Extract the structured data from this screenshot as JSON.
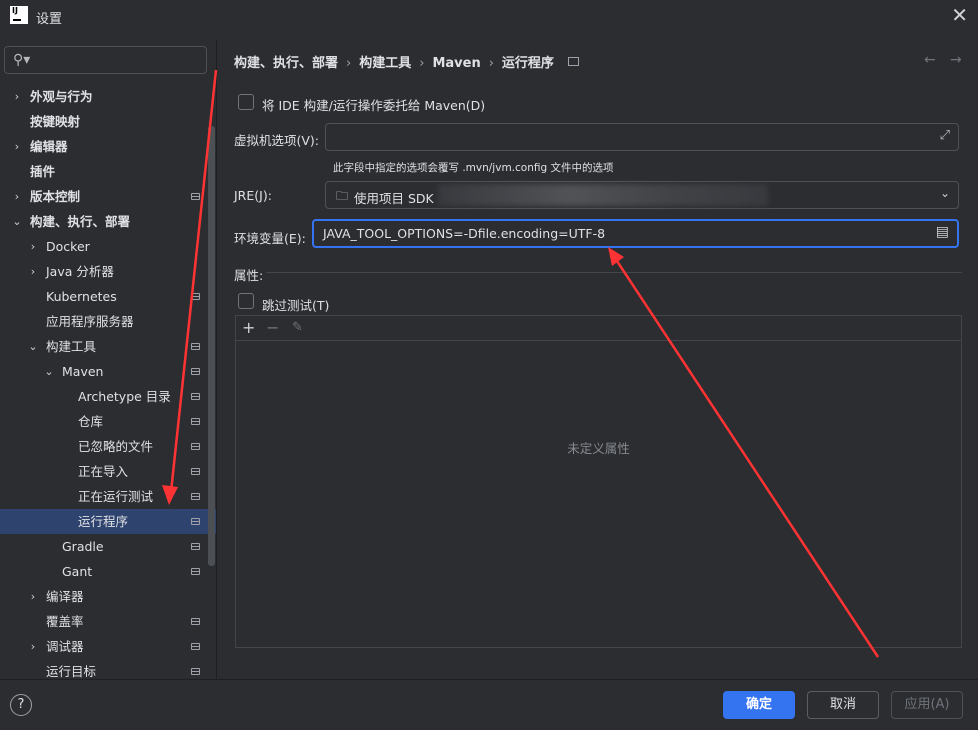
{
  "window": {
    "title": "设置",
    "logo": "IJ"
  },
  "search": {
    "placeholder": "",
    "icon": "search-icon"
  },
  "sidebar": {
    "items": [
      {
        "label": "外观与行为",
        "expandable": true,
        "bold": true
      },
      {
        "label": "按键映射",
        "bold": true
      },
      {
        "label": "编辑器",
        "expandable": true,
        "bold": true
      },
      {
        "label": "插件",
        "bold": true
      },
      {
        "label": "版本控制",
        "expandable": true,
        "bold": true
      },
      {
        "label": "构建、执行、部署",
        "expanded": true,
        "bold": true
      },
      {
        "label": "Docker",
        "expandable": true
      },
      {
        "label": "Java 分析器",
        "expandable": true
      },
      {
        "label": "Kubernetes"
      },
      {
        "label": "应用程序服务器"
      },
      {
        "label": "构建工具",
        "expanded": true
      },
      {
        "label": "Maven",
        "expanded": true
      },
      {
        "label": "Archetype 目录"
      },
      {
        "label": "仓库"
      },
      {
        "label": "已忽略的文件"
      },
      {
        "label": "正在导入"
      },
      {
        "label": "正在运行测试"
      },
      {
        "label": "运行程序",
        "selected": true
      },
      {
        "label": "Gradle"
      },
      {
        "label": "Gant"
      },
      {
        "label": "编译器",
        "expandable": true
      },
      {
        "label": "覆盖率"
      },
      {
        "label": "调试器",
        "expandable": true
      },
      {
        "label": "运行目标"
      }
    ]
  },
  "breadcrumb": [
    "构建、执行、部署",
    "构建工具",
    "Maven",
    "运行程序"
  ],
  "form": {
    "delegate_label": "将 IDE 构建/运行操作委托给 Maven(D)",
    "vm_label": "虚拟机选项(V):",
    "vm_value": "",
    "vm_hint": "此字段中指定的选项会覆写 .mvn/jvm.config 文件中的选项",
    "jre_label": "JRE(J):",
    "jre_value": "使用项目 SDK",
    "env_label": "环境变量(E):",
    "env_value": "JAVA_TOOL_OPTIONS=-Dfile.encoding=UTF-8",
    "props_label": "属性:",
    "skip_tests_label": "跳过测试(T)",
    "empty_props": "未定义属性"
  },
  "footer": {
    "ok": "确定",
    "cancel": "取消",
    "apply": "应用(A)",
    "help": "?"
  },
  "colors": {
    "accent": "#3574f0",
    "annotation": "#ff3333",
    "selection": "#2e436e"
  }
}
